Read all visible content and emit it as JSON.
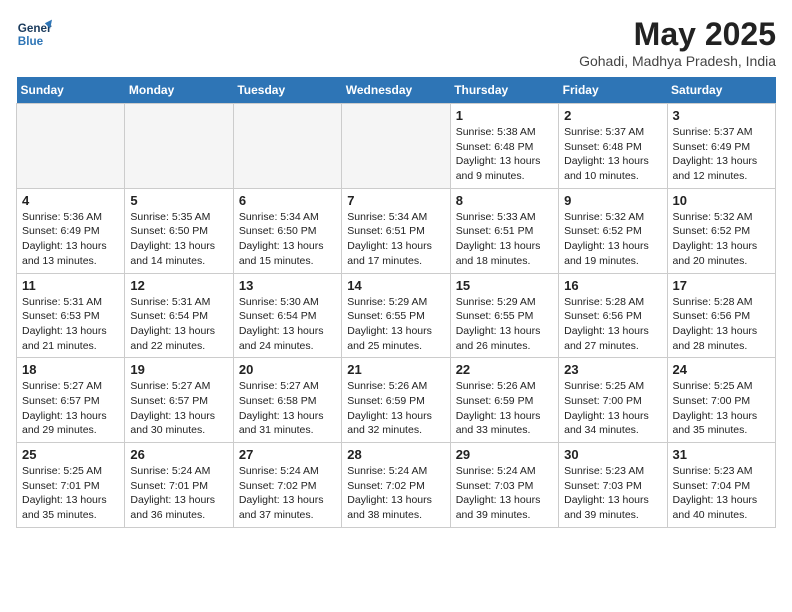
{
  "header": {
    "logo_line1": "General",
    "logo_line2": "Blue",
    "month_title": "May 2025",
    "location": "Gohadi, Madhya Pradesh, India"
  },
  "weekdays": [
    "Sunday",
    "Monday",
    "Tuesday",
    "Wednesday",
    "Thursday",
    "Friday",
    "Saturday"
  ],
  "weeks": [
    [
      {
        "day": "",
        "empty": true
      },
      {
        "day": "",
        "empty": true
      },
      {
        "day": "",
        "empty": true
      },
      {
        "day": "",
        "empty": true
      },
      {
        "day": "1",
        "sunrise": "5:38 AM",
        "sunset": "6:48 PM",
        "daylight": "13 hours and 9 minutes."
      },
      {
        "day": "2",
        "sunrise": "5:37 AM",
        "sunset": "6:48 PM",
        "daylight": "13 hours and 10 minutes."
      },
      {
        "day": "3",
        "sunrise": "5:37 AM",
        "sunset": "6:49 PM",
        "daylight": "13 hours and 12 minutes."
      }
    ],
    [
      {
        "day": "4",
        "sunrise": "5:36 AM",
        "sunset": "6:49 PM",
        "daylight": "13 hours and 13 minutes."
      },
      {
        "day": "5",
        "sunrise": "5:35 AM",
        "sunset": "6:50 PM",
        "daylight": "13 hours and 14 minutes."
      },
      {
        "day": "6",
        "sunrise": "5:34 AM",
        "sunset": "6:50 PM",
        "daylight": "13 hours and 15 minutes."
      },
      {
        "day": "7",
        "sunrise": "5:34 AM",
        "sunset": "6:51 PM",
        "daylight": "13 hours and 17 minutes."
      },
      {
        "day": "8",
        "sunrise": "5:33 AM",
        "sunset": "6:51 PM",
        "daylight": "13 hours and 18 minutes."
      },
      {
        "day": "9",
        "sunrise": "5:32 AM",
        "sunset": "6:52 PM",
        "daylight": "13 hours and 19 minutes."
      },
      {
        "day": "10",
        "sunrise": "5:32 AM",
        "sunset": "6:52 PM",
        "daylight": "13 hours and 20 minutes."
      }
    ],
    [
      {
        "day": "11",
        "sunrise": "5:31 AM",
        "sunset": "6:53 PM",
        "daylight": "13 hours and 21 minutes."
      },
      {
        "day": "12",
        "sunrise": "5:31 AM",
        "sunset": "6:54 PM",
        "daylight": "13 hours and 22 minutes."
      },
      {
        "day": "13",
        "sunrise": "5:30 AM",
        "sunset": "6:54 PM",
        "daylight": "13 hours and 24 minutes."
      },
      {
        "day": "14",
        "sunrise": "5:29 AM",
        "sunset": "6:55 PM",
        "daylight": "13 hours and 25 minutes."
      },
      {
        "day": "15",
        "sunrise": "5:29 AM",
        "sunset": "6:55 PM",
        "daylight": "13 hours and 26 minutes."
      },
      {
        "day": "16",
        "sunrise": "5:28 AM",
        "sunset": "6:56 PM",
        "daylight": "13 hours and 27 minutes."
      },
      {
        "day": "17",
        "sunrise": "5:28 AM",
        "sunset": "6:56 PM",
        "daylight": "13 hours and 28 minutes."
      }
    ],
    [
      {
        "day": "18",
        "sunrise": "5:27 AM",
        "sunset": "6:57 PM",
        "daylight": "13 hours and 29 minutes."
      },
      {
        "day": "19",
        "sunrise": "5:27 AM",
        "sunset": "6:57 PM",
        "daylight": "13 hours and 30 minutes."
      },
      {
        "day": "20",
        "sunrise": "5:27 AM",
        "sunset": "6:58 PM",
        "daylight": "13 hours and 31 minutes."
      },
      {
        "day": "21",
        "sunrise": "5:26 AM",
        "sunset": "6:59 PM",
        "daylight": "13 hours and 32 minutes."
      },
      {
        "day": "22",
        "sunrise": "5:26 AM",
        "sunset": "6:59 PM",
        "daylight": "13 hours and 33 minutes."
      },
      {
        "day": "23",
        "sunrise": "5:25 AM",
        "sunset": "7:00 PM",
        "daylight": "13 hours and 34 minutes."
      },
      {
        "day": "24",
        "sunrise": "5:25 AM",
        "sunset": "7:00 PM",
        "daylight": "13 hours and 35 minutes."
      }
    ],
    [
      {
        "day": "25",
        "sunrise": "5:25 AM",
        "sunset": "7:01 PM",
        "daylight": "13 hours and 35 minutes."
      },
      {
        "day": "26",
        "sunrise": "5:24 AM",
        "sunset": "7:01 PM",
        "daylight": "13 hours and 36 minutes."
      },
      {
        "day": "27",
        "sunrise": "5:24 AM",
        "sunset": "7:02 PM",
        "daylight": "13 hours and 37 minutes."
      },
      {
        "day": "28",
        "sunrise": "5:24 AM",
        "sunset": "7:02 PM",
        "daylight": "13 hours and 38 minutes."
      },
      {
        "day": "29",
        "sunrise": "5:24 AM",
        "sunset": "7:03 PM",
        "daylight": "13 hours and 39 minutes."
      },
      {
        "day": "30",
        "sunrise": "5:23 AM",
        "sunset": "7:03 PM",
        "daylight": "13 hours and 39 minutes."
      },
      {
        "day": "31",
        "sunrise": "5:23 AM",
        "sunset": "7:04 PM",
        "daylight": "13 hours and 40 minutes."
      }
    ]
  ]
}
